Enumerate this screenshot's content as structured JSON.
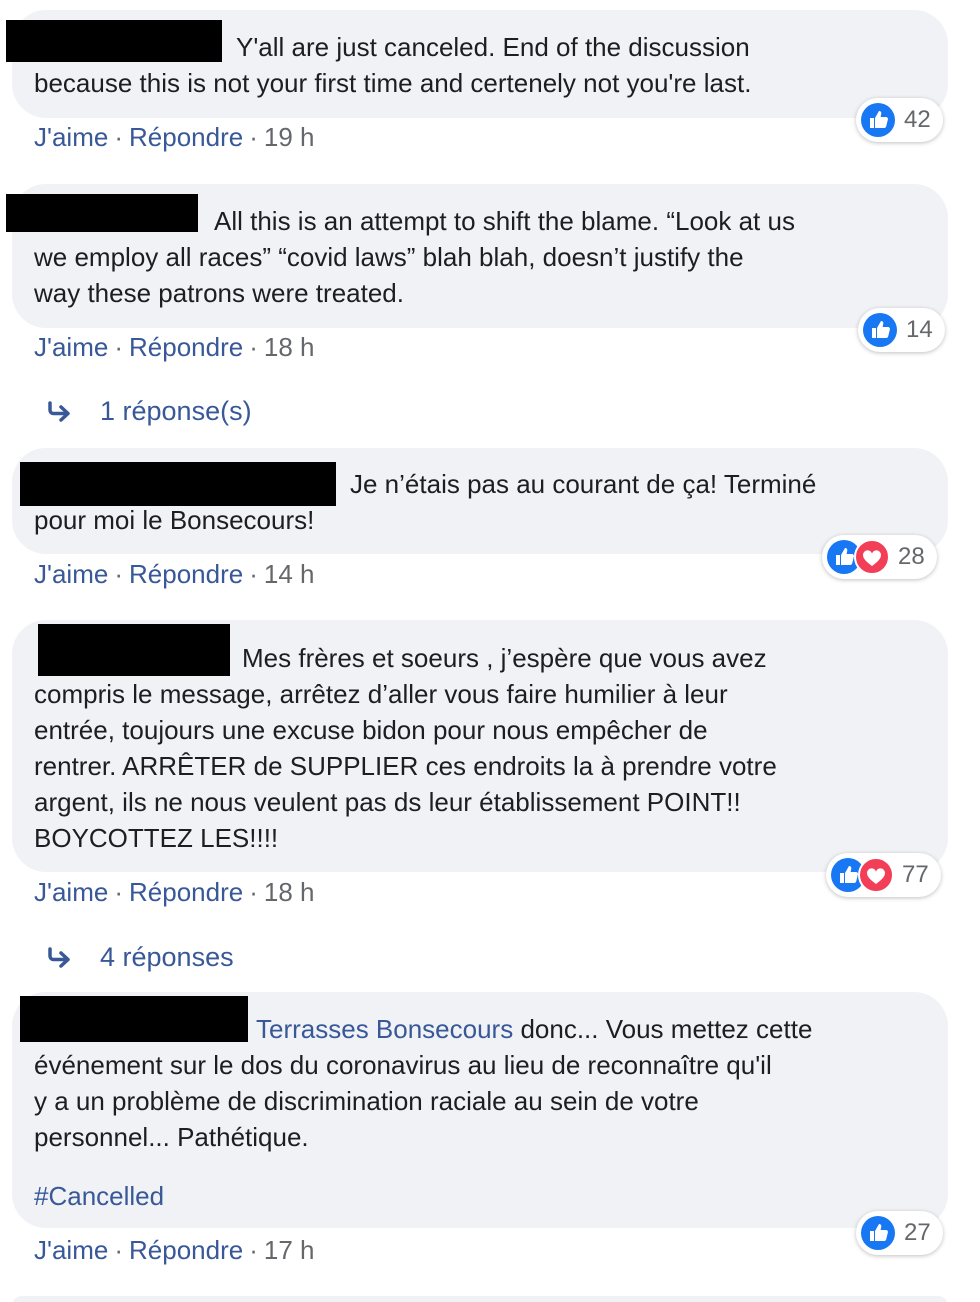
{
  "comments": [
    {
      "line1": "Y'all are just canceled. End of the discussion",
      "rest": "because this is not your first time and certenely not you're last.",
      "like": "J'aime",
      "reply": "Répondre",
      "time": "19 h",
      "reaction_count": "42",
      "reaction_icons": [
        "like-icon"
      ]
    },
    {
      "line1": "All this is an attempt to shift the blame. “Look at us",
      "rest": "we employ all races” “covid laws” blah blah, doesn’t justify the\nway these patrons were treated.",
      "like": "J'aime",
      "reply": "Répondre",
      "time": "18 h",
      "reaction_count": "14",
      "reaction_icons": [
        "like-icon"
      ],
      "replies_label": "1 réponse(s)"
    },
    {
      "line1": "Je n’étais pas au courant de ça! Terminé",
      "rest": "pour moi le Bonsecours!",
      "like": "J'aime",
      "reply": "Répondre",
      "time": "14 h",
      "reaction_count": "28",
      "reaction_icons": [
        "like-icon",
        "love-icon"
      ]
    },
    {
      "line1": "Mes frères et soeurs , j’espère que vous avez",
      "rest": "compris le message, arrêtez d’aller vous faire humilier à leur\nentrée, toujours une excuse bidon pour nous empêcher de\nrentrer. ARRÊTER de SUPPLIER ces endroits la à prendre votre\nargent, ils ne nous veulent pas ds leur établissement POINT!!\nBOYCOTTEZ LES!!!!",
      "like": "J'aime",
      "reply": "Répondre",
      "time": "18 h",
      "reaction_count": "77",
      "reaction_icons": [
        "like-icon",
        "love-icon"
      ],
      "replies_label": "4 réponses"
    },
    {
      "mention": "Terrasses Bonsecours",
      "line1": " donc... Vous mettez cette",
      "rest": "événement sur le dos du coronavirus au lieu de reconnaître qu'il\ny a un problème de discrimination raciale au sein de votre\npersonnel... Pathétique.",
      "hashtag": "#Cancelled",
      "like": "J'aime",
      "reply": "Répondre",
      "time": "17 h",
      "reaction_count": "27",
      "reaction_icons": [
        "like-icon"
      ]
    }
  ],
  "colors": {
    "bubble": "#f0f2f5",
    "link": "#385898",
    "meta": "#65676b",
    "like_blue": "#1877f2",
    "love_red": "#f33e58"
  }
}
